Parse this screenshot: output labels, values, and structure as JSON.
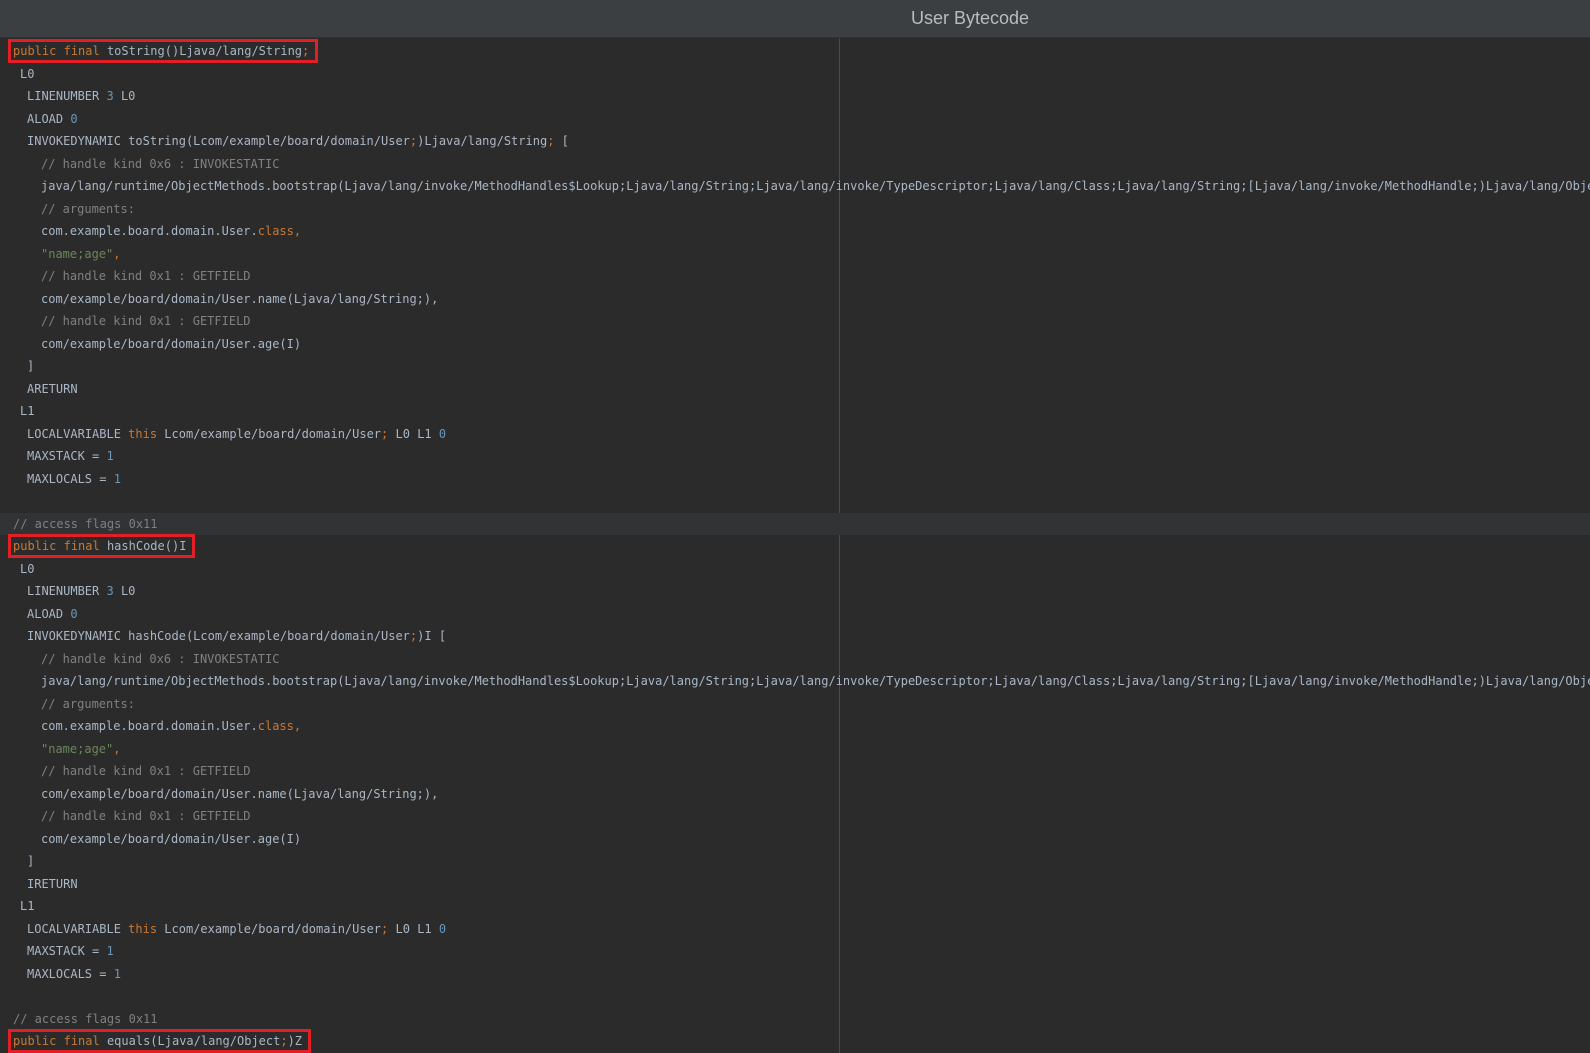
{
  "window": {
    "title": "User Bytecode"
  },
  "colors": {
    "background": "#2b2b2b",
    "titlebar": "#3c3f41",
    "highlight_box": "#e31e24",
    "keyword": "#cc7832",
    "number": "#6897bb",
    "string": "#6a8759",
    "comment": "#808080",
    "text": "#a9b7c6"
  },
  "methods": [
    {
      "sig_public": "public",
      "sig_final": "final",
      "sig_name": "toString()Ljava/lang/String",
      "l0": "L0",
      "linenumber": "LINENUMBER",
      "linenumber_val": "3",
      "linenumber_label": "L0",
      "aload": "ALOAD",
      "aload_val": "0",
      "invoke_prefix": "INVOKEDYNAMIC toString(Lcom/example/board/domain/User",
      "invoke_suffix": ")Ljava/lang/String",
      "invoke_open": "[",
      "handle1": "// handle kind 0x6 : INVOKESTATIC",
      "bootstrap": "java/lang/runtime/ObjectMethods.bootstrap(Ljava/lang/invoke/MethodHandles$Lookup;Ljava/lang/String;Ljava/lang/invoke/TypeDescriptor;Ljava/lang/Class;Ljava/lang/String;[Ljava/lang/invoke/MethodHandle;)Ljava/lang/Object;",
      "arguments": "// arguments:",
      "arg_class_prefix": "com.example.board.domain.User.",
      "arg_class_kw": "class",
      "arg_string": "\"name;age\"",
      "handle2": "// handle kind 0x1 : GETFIELD",
      "field_name": "com/example/board/domain/User.name(Ljava/lang/String;),",
      "handle3": "// handle kind 0x1 : GETFIELD",
      "field_age": "com/example/board/domain/User.age(I)",
      "close": "]",
      "return_op": "ARETURN",
      "l1": "L1",
      "localvar": "LOCALVARIABLE",
      "localvar_this": "this",
      "localvar_type": "Lcom/example/board/domain/User",
      "localvar_labels": "L0 L1",
      "localvar_idx": "0",
      "maxstack": "MAXSTACK =",
      "maxstack_val": "1",
      "maxlocals": "MAXLOCALS =",
      "maxlocals_val": "1"
    },
    {
      "access_comment": "// access flags 0x11",
      "sig_public": "public",
      "sig_final": "final",
      "sig_name": "hashCode()I",
      "l0": "L0",
      "linenumber": "LINENUMBER",
      "linenumber_val": "3",
      "linenumber_label": "L0",
      "aload": "ALOAD",
      "aload_val": "0",
      "invoke_prefix": "INVOKEDYNAMIC hashCode(Lcom/example/board/domain/User",
      "invoke_suffix": ")I",
      "invoke_open": "[",
      "handle1": "// handle kind 0x6 : INVOKESTATIC",
      "bootstrap": "java/lang/runtime/ObjectMethods.bootstrap(Ljava/lang/invoke/MethodHandles$Lookup;Ljava/lang/String;Ljava/lang/invoke/TypeDescriptor;Ljava/lang/Class;Ljava/lang/String;[Ljava/lang/invoke/MethodHandle;)Ljava/lang/Object;",
      "arguments": "// arguments:",
      "arg_class_prefix": "com.example.board.domain.User.",
      "arg_class_kw": "class",
      "arg_string": "\"name;age\"",
      "handle2": "// handle kind 0x1 : GETFIELD",
      "field_name": "com/example/board/domain/User.name(Ljava/lang/String;),",
      "handle3": "// handle kind 0x1 : GETFIELD",
      "field_age": "com/example/board/domain/User.age(I)",
      "close": "]",
      "return_op": "IRETURN",
      "l1": "L1",
      "localvar": "LOCALVARIABLE",
      "localvar_this": "this",
      "localvar_type": "Lcom/example/board/domain/User",
      "localvar_labels": "L0 L1",
      "localvar_idx": "0",
      "maxstack": "MAXSTACK =",
      "maxstack_val": "1",
      "maxlocals": "MAXLOCALS =",
      "maxlocals_val": "1"
    },
    {
      "access_comment": "// access flags 0x11",
      "sig_public": "public",
      "sig_final": "final",
      "sig_name": "equals(Ljava/lang/Object",
      "sig_suffix": ")Z"
    }
  ]
}
